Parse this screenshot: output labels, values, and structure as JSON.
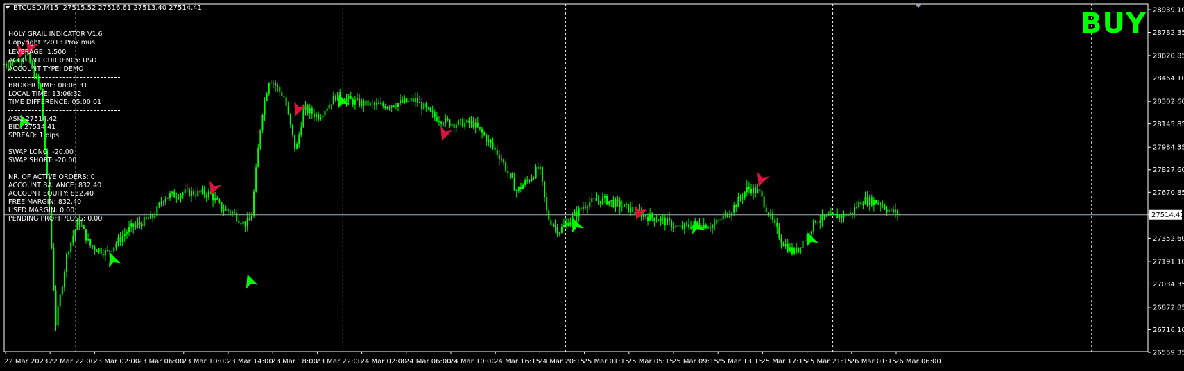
{
  "header": {
    "symbol": "BTCUSD,M15",
    "ohlc": "27515.52 27516.61 27513.40 27514.41"
  },
  "signal": {
    "label": "BUY",
    "color": "#00ff00"
  },
  "colors": {
    "background": "#000000",
    "candles": "#00ff00",
    "bullish_arrow": "#00ff00",
    "bearish_arrow": "#dc143c",
    "grid": "#ffffff",
    "price_line": "#a9b4bf"
  },
  "info_panel": {
    "title": "HOLY GRAIL INDICATOR V1.6",
    "copyright": "Copyright ?2013 Proximus",
    "account": [
      "LEVERAGE:   1:500",
      "ACCOUNT CURRENCY:   USD",
      "ACCOUNT TYPE:   DEMO"
    ],
    "time": [
      "BROKER TIME:   08:06:31",
      "LOCAL TIME:   13:06:32",
      "TIME DIFFERENCE:   05:00:01"
    ],
    "prices": [
      "ASK:   27514.42",
      "BID:   27514.41",
      "SPREAD:   1 pips"
    ],
    "swap": [
      "SWAP LONG:   -20.00",
      "SWAP SHORT:   -20.00"
    ],
    "orders": [
      "NR. OF ACTIVE ORDERS:   0",
      "ACCOUNT BALANCE:   832.40",
      "ACCOUNT EQUITY:   832.40",
      "FREE MARGIN:   832.40",
      "USED MARGIN:   0.00",
      "PENDING PROFIT/LOSS:   0.00"
    ]
  },
  "chart_data": {
    "type": "candlestick",
    "current_price": "27514.41",
    "ylim": [
      26559.35,
      28939.1
    ],
    "y_ticks": [
      "28939.10",
      "28782.35",
      "28620.85",
      "28464.10",
      "28302.60",
      "28145.85",
      "27984.35",
      "27827.60",
      "27670.85",
      "27514.41",
      "27352.60",
      "27191.10",
      "27034.35",
      "26872.85",
      "26716.10",
      "26559.35"
    ],
    "x_ticks": [
      "22 Mar 2023",
      "22 Mar 22:00",
      "23 Mar 02:00",
      "23 Mar 06:00",
      "23 Mar 10:00",
      "23 Mar 14:00",
      "23 Mar 18:00",
      "23 Mar 22:00",
      "24 Mar 02:00",
      "24 Mar 06:00",
      "24 Mar 10:00",
      "24 Mar 16:15",
      "24 Mar 20:15",
      "25 Mar 01:15",
      "25 Mar 05:15",
      "25 Mar 09:15",
      "25 Mar 13:15",
      "25 Mar 17:15",
      "25 Mar 21:15",
      "26 Mar 01:15",
      "26 Mar 06:00"
    ],
    "day_separators_at_ticks": [
      1,
      7,
      12,
      18
    ],
    "extra_separator_fraction": 0.935,
    "close_path": [
      [
        0.0,
        28560
      ],
      [
        0.02,
        28620
      ],
      [
        0.032,
        28380
      ],
      [
        0.04,
        27500
      ],
      [
        0.045,
        26750
      ],
      [
        0.055,
        27250
      ],
      [
        0.065,
        27480
      ],
      [
        0.075,
        27300
      ],
      [
        0.09,
        27250
      ],
      [
        0.11,
        27420
      ],
      [
        0.13,
        27500
      ],
      [
        0.14,
        27640
      ],
      [
        0.16,
        27670
      ],
      [
        0.18,
        27660
      ],
      [
        0.19,
        27560
      ],
      [
        0.2,
        27530
      ],
      [
        0.21,
        27450
      ],
      [
        0.216,
        27480
      ],
      [
        0.225,
        28200
      ],
      [
        0.232,
        28470
      ],
      [
        0.245,
        28330
      ],
      [
        0.255,
        27950
      ],
      [
        0.262,
        28250
      ],
      [
        0.275,
        28200
      ],
      [
        0.29,
        28340
      ],
      [
        0.31,
        28290
      ],
      [
        0.33,
        28270
      ],
      [
        0.36,
        28310
      ],
      [
        0.375,
        28200
      ],
      [
        0.39,
        28150
      ],
      [
        0.41,
        28150
      ],
      [
        0.42,
        28060
      ],
      [
        0.435,
        27900
      ],
      [
        0.448,
        27680
      ],
      [
        0.46,
        27770
      ],
      [
        0.468,
        27850
      ],
      [
        0.475,
        27500
      ],
      [
        0.485,
        27400
      ],
      [
        0.495,
        27480
      ],
      [
        0.51,
        27600
      ],
      [
        0.525,
        27620
      ],
      [
        0.545,
        27560
      ],
      [
        0.56,
        27510
      ],
      [
        0.575,
        27480
      ],
      [
        0.59,
        27420
      ],
      [
        0.605,
        27450
      ],
      [
        0.62,
        27440
      ],
      [
        0.635,
        27540
      ],
      [
        0.65,
        27700
      ],
      [
        0.66,
        27670
      ],
      [
        0.668,
        27530
      ],
      [
        0.68,
        27330
      ],
      [
        0.69,
        27250
      ],
      [
        0.7,
        27350
      ],
      [
        0.71,
        27480
      ],
      [
        0.725,
        27500
      ],
      [
        0.74,
        27520
      ],
      [
        0.75,
        27620
      ],
      [
        0.765,
        27600
      ],
      [
        0.775,
        27540
      ],
      [
        0.783,
        27520
      ]
    ],
    "buy_arrows": [
      [
        0.017,
        28160
      ],
      [
        0.095,
        27200
      ],
      [
        0.215,
        27050
      ],
      [
        0.295,
        28300
      ],
      [
        0.5,
        27440
      ],
      [
        0.605,
        27430
      ],
      [
        0.705,
        27340
      ]
    ],
    "sell_arrows": [
      [
        0.015,
        28650
      ],
      [
        0.023,
        28680
      ],
      [
        0.183,
        27700
      ],
      [
        0.257,
        28250
      ],
      [
        0.385,
        28080
      ],
      [
        0.555,
        27530
      ],
      [
        0.662,
        27760
      ]
    ]
  }
}
